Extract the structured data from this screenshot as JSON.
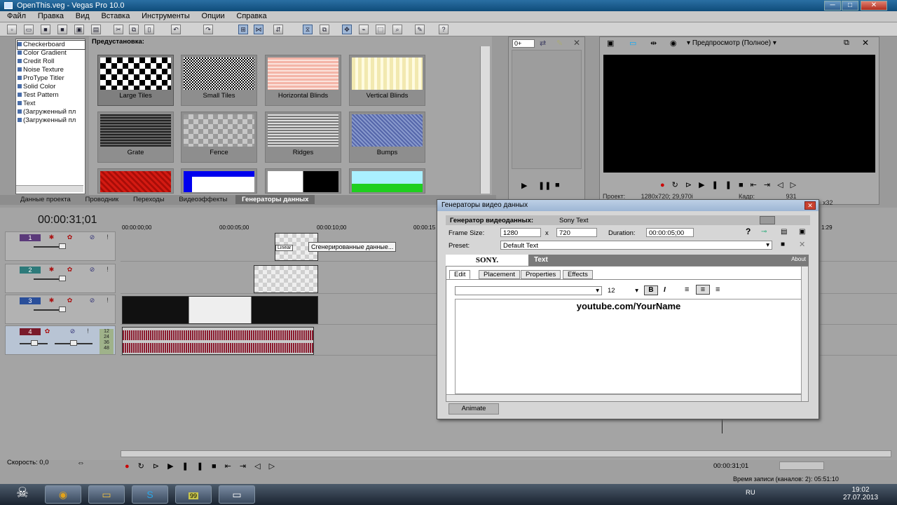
{
  "window": {
    "title": "OpenThis.veg - Vegas Pro 10.0",
    "min": "─",
    "max": "□",
    "close": "✕"
  },
  "menu": [
    "Файл",
    "Правка",
    "Вид",
    "Вставка",
    "Инструменты",
    "Опции",
    "Справка"
  ],
  "generators": {
    "list": [
      "Checkerboard",
      "Color Gradient",
      "Credit Roll",
      "Noise Texture",
      "ProType Titler",
      "Solid Color",
      "Test Pattern",
      "Text",
      "(Загруженный пл",
      "(Загруженный пл"
    ],
    "preset_header": "Предустановка:",
    "thumbs": [
      "Large Tiles",
      "Small Tiles",
      "Horizontal Blinds",
      "Vertical Blinds",
      "Grate",
      "Fence",
      "Ridges",
      "Bumps"
    ]
  },
  "tabs": [
    "Данные проекта",
    "Проводник",
    "Переходы",
    "Видеоэффекты",
    "Генераторы данных"
  ],
  "trimmer": {
    "zoom": "0+"
  },
  "preview": {
    "mode": "Предпросмотр (Полное)",
    "project_label": "Проект:",
    "project_value": "1280x720; 29,970i",
    "frame_label": "Кадр:",
    "frame_value": "931",
    "extra": "x32"
  },
  "timeline": {
    "timecode": "00:00:31;01",
    "ruler": [
      "00:00:00;00",
      "00:00:05;00",
      "00:00:10;00",
      "00:00:15",
      "1:29"
    ],
    "tracks": [
      "1",
      "2",
      "3",
      "4"
    ],
    "meter": [
      "12",
      "24",
      "36",
      "48"
    ],
    "tooltip": "Сгенерированные данные...",
    "linear": "Linear"
  },
  "dialog": {
    "title": "Генераторы видео данных",
    "gen_label": "Генератор видеоданных:",
    "gen_value": "Sony Text",
    "frame_size_label": "Frame Size:",
    "width": "1280",
    "x": "x",
    "height": "720",
    "duration_label": "Duration:",
    "duration": "00:00:05;00",
    "preset_label": "Preset:",
    "preset": "Default Text",
    "sony": "SONY.",
    "text_tab": "Text",
    "about": "About",
    "tabs": [
      "Edit",
      "Placement",
      "Properties",
      "Effects"
    ],
    "font_size": "12",
    "bold": "B",
    "italic": "I",
    "content": "youtube.com/YourName",
    "animate": "Animate"
  },
  "status": {
    "speed": "Скорость: 0,0",
    "time": "00:00:31;01",
    "record": "Время записи (каналов: 2): 05:51:10"
  },
  "taskbar": {
    "lang": "RU",
    "clock": "19:02",
    "date": "27.07.2013",
    "badge": "99"
  }
}
